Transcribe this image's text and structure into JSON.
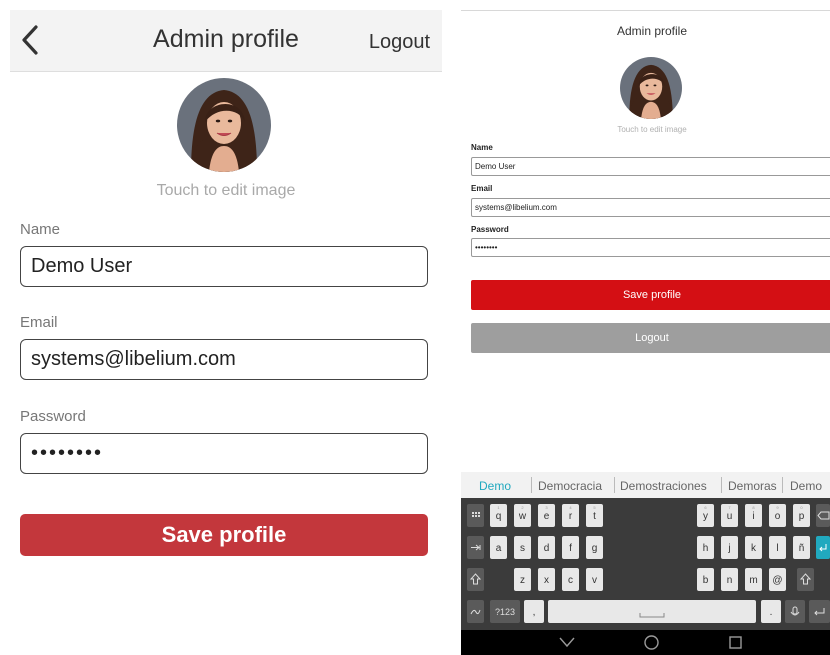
{
  "ios": {
    "title": "Admin profile",
    "logout_label": "Logout",
    "avatar_hint": "Touch to edit image",
    "name_label": "Name",
    "name_value": "Demo User",
    "email_label": "Email",
    "email_value": "systems@libelium.com",
    "password_label": "Password",
    "password_value": "••••••••",
    "save_label": "Save profile",
    "colors": {
      "save_button": "#c3373c",
      "nav_bg": "#f3f3f3"
    },
    "icons": {
      "back": "chevron-left-icon"
    }
  },
  "android": {
    "title": "Admin profile",
    "avatar_hint": "Touch to edit image",
    "name_label": "Name",
    "name_value": "Demo User",
    "email_label": "Email",
    "email_value": "systems@libelium.com",
    "password_label": "Password",
    "password_value": "••••••••",
    "save_label": "Save profile",
    "logout_label": "Logout",
    "colors": {
      "save_button": "#d40f14",
      "logout_button": "#9e9e9e",
      "suggestion_active": "#21a9bf"
    },
    "keyboard": {
      "suggestions": [
        "Demo",
        "Democracia",
        "Demostraciones",
        "Demoras",
        "Demo"
      ],
      "row1": [
        "q",
        "w",
        "e",
        "r",
        "t",
        "y",
        "u",
        "i",
        "o",
        "p"
      ],
      "row2": [
        "a",
        "s",
        "d",
        "f",
        "g",
        "h",
        "j",
        "k",
        "l",
        "ñ"
      ],
      "row3": [
        "z",
        "x",
        "c",
        "v",
        "b",
        "n",
        "m",
        "@"
      ],
      "symbols_label": "?123",
      "row1_hints": [
        "1",
        "2",
        "3",
        "4",
        "5",
        "6",
        "7",
        "8",
        "9",
        "0"
      ],
      "icons": [
        "emoji-grid-icon",
        "tab-icon",
        "shift-icon",
        "backspace-icon",
        "voice-icon",
        "enter-icon",
        "space-icon"
      ]
    },
    "navbar_icons": [
      "back-triangle-icon",
      "home-circle-icon",
      "recents-square-icon"
    ]
  }
}
